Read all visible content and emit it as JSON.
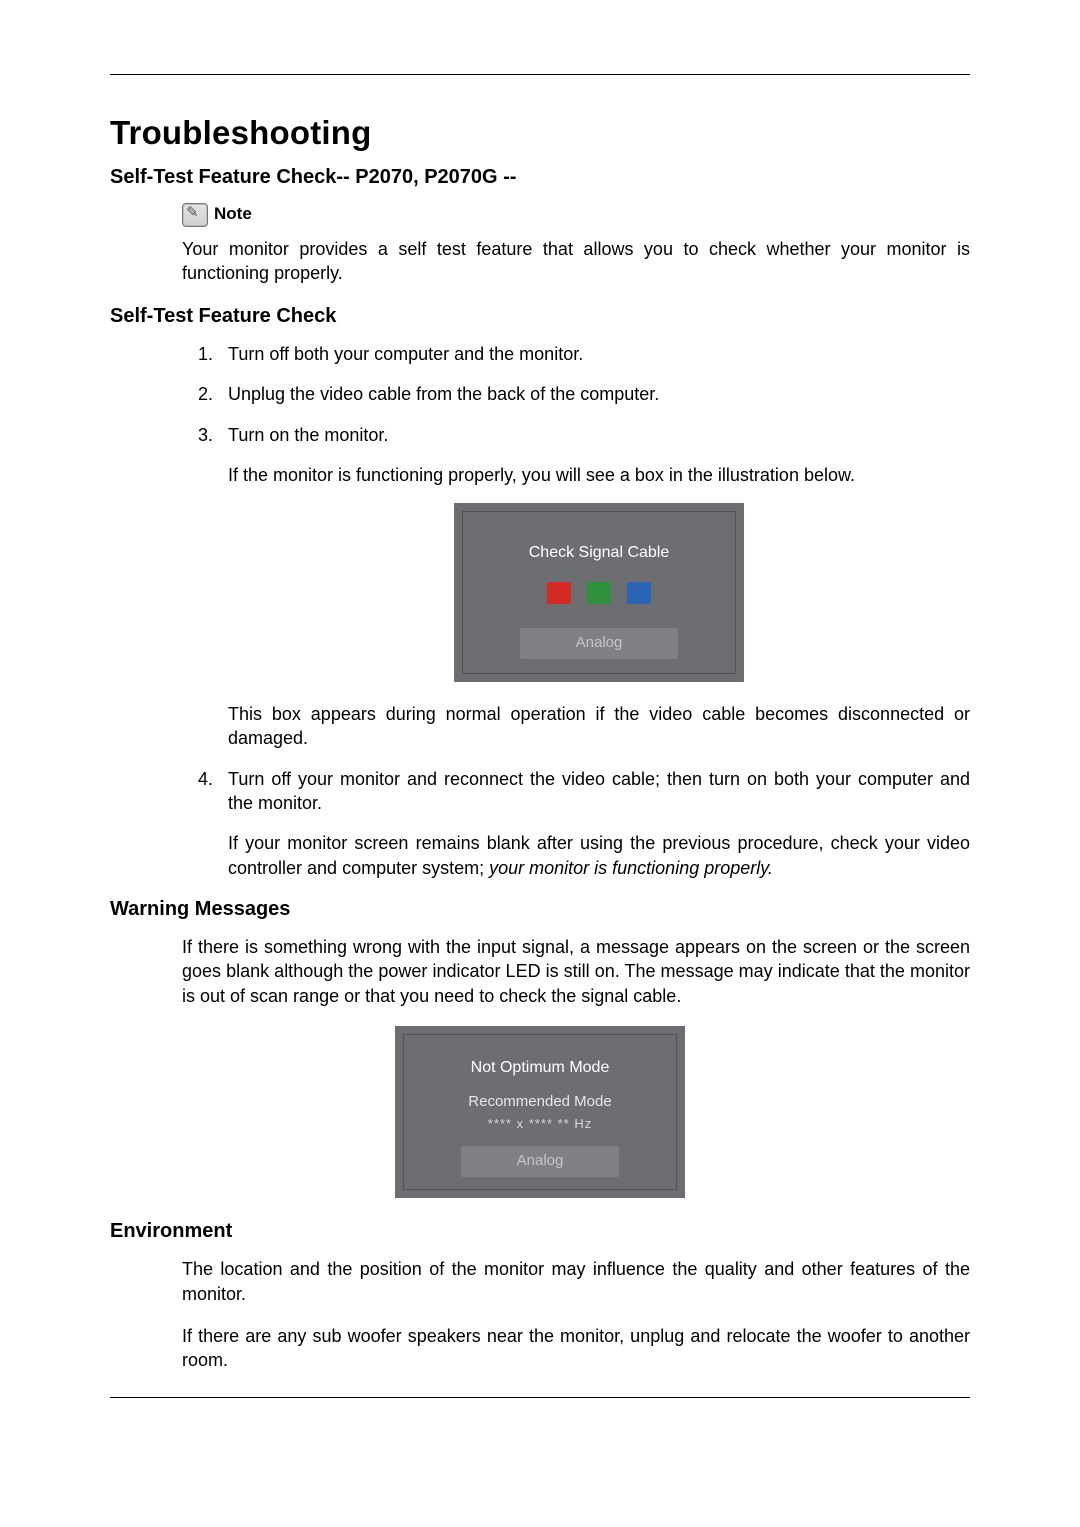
{
  "title": "Troubleshooting",
  "section1": {
    "heading": "Self-Test Feature Check-- P2070, P2070G --",
    "note_label": "Note",
    "note_body": "Your monitor provides a self test feature that allows you to check whether your monitor is functioning properly."
  },
  "section2": {
    "heading": "Self-Test Feature Check",
    "steps": {
      "s1": "Turn off both your computer and the monitor.",
      "s2": "Unplug the video cable from the back of the computer.",
      "s3": "Turn on the monitor.",
      "s3_sub": "If the monitor is functioning properly, you will see a box in the illustration below.",
      "s3_after": "This box appears during normal operation if the video cable becomes disconnected or damaged.",
      "s4": "Turn off your monitor and reconnect the video cable; then turn on both your computer and the monitor.",
      "s4_sub": "If your monitor screen remains blank after using the previous procedure, check your video controller and computer system; ",
      "s4_sub_italic": "your monitor is functioning properly."
    }
  },
  "osd1": {
    "line1": "Check Signal Cable",
    "bar": "Analog"
  },
  "section3": {
    "heading": "Warning Messages",
    "body": "If there is something wrong with the input signal, a message appears on the screen or the screen goes blank although the power indicator LED is still on. The message may indicate that the monitor is out of scan range or that you need to check the signal cable."
  },
  "osd2": {
    "line1": "Not  Optimum Mode",
    "line2": "Recommended Mode",
    "line3": "**** x ****   ** Hz",
    "bar": "Analog"
  },
  "section4": {
    "heading": "Environment",
    "p1": "The location and the position of the monitor may influence the quality and other features of the monitor.",
    "p2": "If there are any sub woofer speakers near the monitor, unplug and relocate the woofer to another room."
  }
}
